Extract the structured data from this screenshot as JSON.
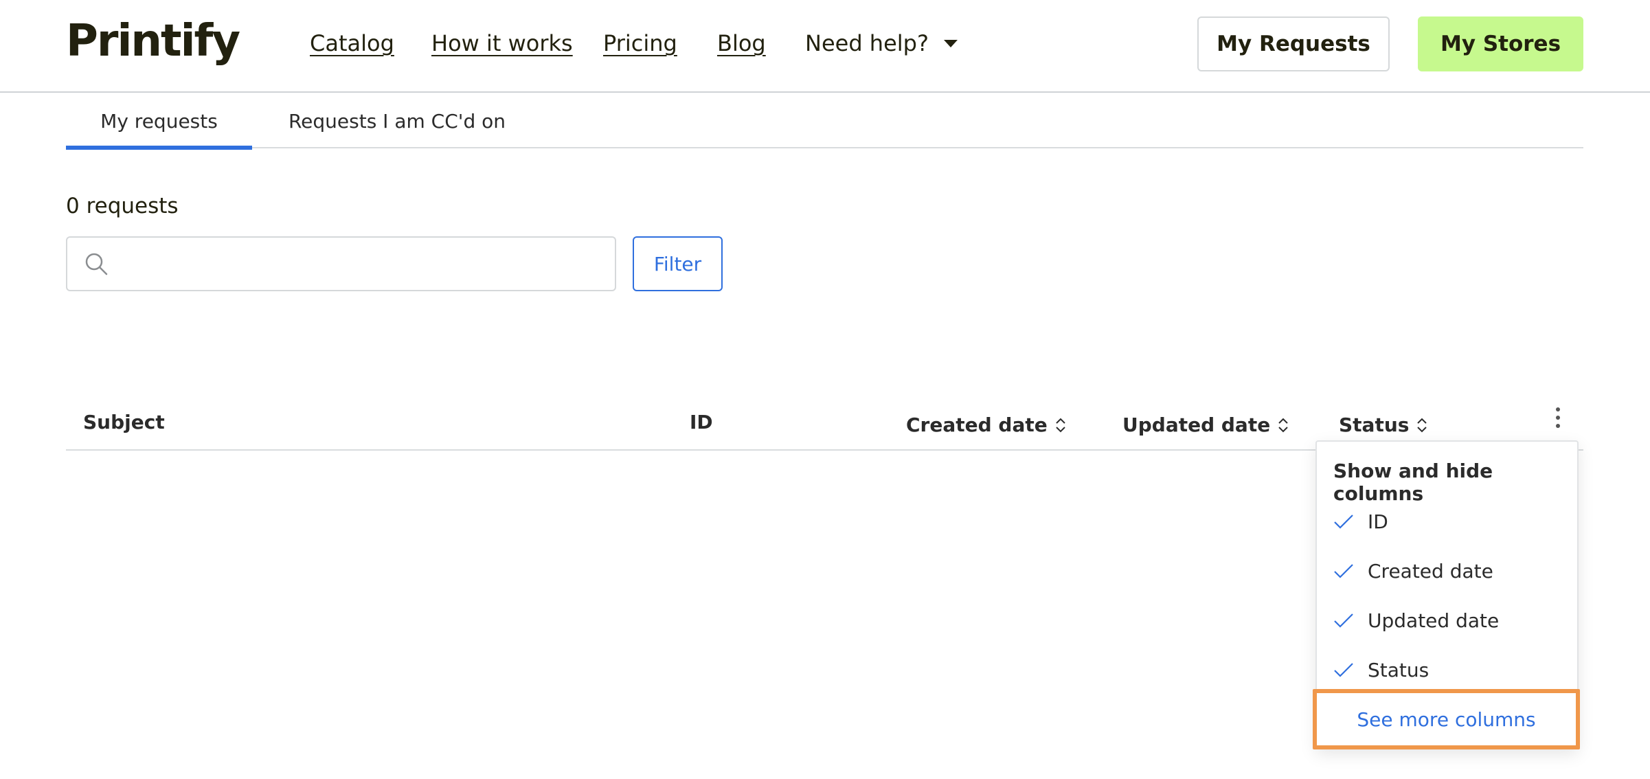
{
  "header": {
    "logo_text": "Printify",
    "nav": [
      {
        "label": "Catalog"
      },
      {
        "label": "How it works"
      },
      {
        "label": "Pricing"
      },
      {
        "label": "Blog"
      }
    ],
    "help_label": "Need help?",
    "my_requests_label": "My Requests",
    "my_stores_label": "My Stores",
    "accent_color": "#c6f98e"
  },
  "tabs": [
    {
      "label": "My requests",
      "active": true
    },
    {
      "label": "Requests I am CC'd on",
      "active": false
    }
  ],
  "requests_count": "0 requests",
  "search": {
    "placeholder": "",
    "value": ""
  },
  "filter_label": "Filter",
  "table": {
    "columns": [
      "Subject",
      "ID",
      "Created date",
      "Updated date",
      "Status"
    ]
  },
  "columns_menu": {
    "title": "Show and hide columns",
    "items": [
      {
        "label": "ID",
        "checked": true
      },
      {
        "label": "Created date",
        "checked": true
      },
      {
        "label": "Updated date",
        "checked": true
      },
      {
        "label": "Status",
        "checked": true
      }
    ],
    "see_more_label": "See more columns",
    "highlight_color": "#f0974a"
  },
  "link_color": "#2f6fde"
}
